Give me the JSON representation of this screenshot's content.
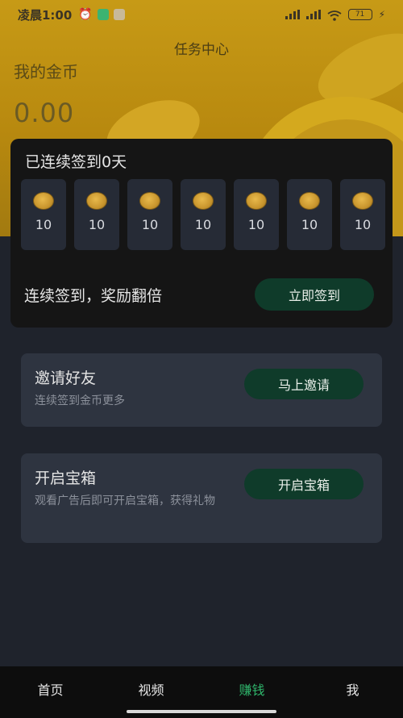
{
  "status_bar": {
    "time": "凌晨1:00",
    "battery": "71",
    "icons": [
      "alarm-icon",
      "app-icon",
      "message-icon",
      "signal-icon",
      "signal-icon",
      "wifi-icon",
      "battery-icon",
      "charging-icon"
    ]
  },
  "header": {
    "title": "任务中心",
    "coins_label": "我的金币",
    "coins_value": "0.00"
  },
  "checkin": {
    "title": "已连续签到0天",
    "days": [
      {
        "amount": "10"
      },
      {
        "amount": "10"
      },
      {
        "amount": "10"
      },
      {
        "amount": "10"
      },
      {
        "amount": "10"
      },
      {
        "amount": "10"
      },
      {
        "amount": "10"
      }
    ],
    "streak_text": "连续签到，奖励翻倍",
    "button_label": "立即签到"
  },
  "tasks": {
    "invite": {
      "title": "邀请好友",
      "desc": "连续签到金币更多",
      "button_label": "马上邀请"
    },
    "chest": {
      "title": "开启宝箱",
      "desc": "观看广告后即可开启宝箱，获得礼物",
      "button_label": "开启宝箱"
    }
  },
  "bottom_nav": {
    "items": [
      {
        "label": "首页"
      },
      {
        "label": "视频"
      },
      {
        "label": "赚钱"
      },
      {
        "label": "我"
      }
    ],
    "active_index": 2
  },
  "colors": {
    "accent_gold": "#c79a16",
    "button_green": "#0f3b2a",
    "nav_active": "#2fb46b",
    "background": "#1f232c"
  }
}
